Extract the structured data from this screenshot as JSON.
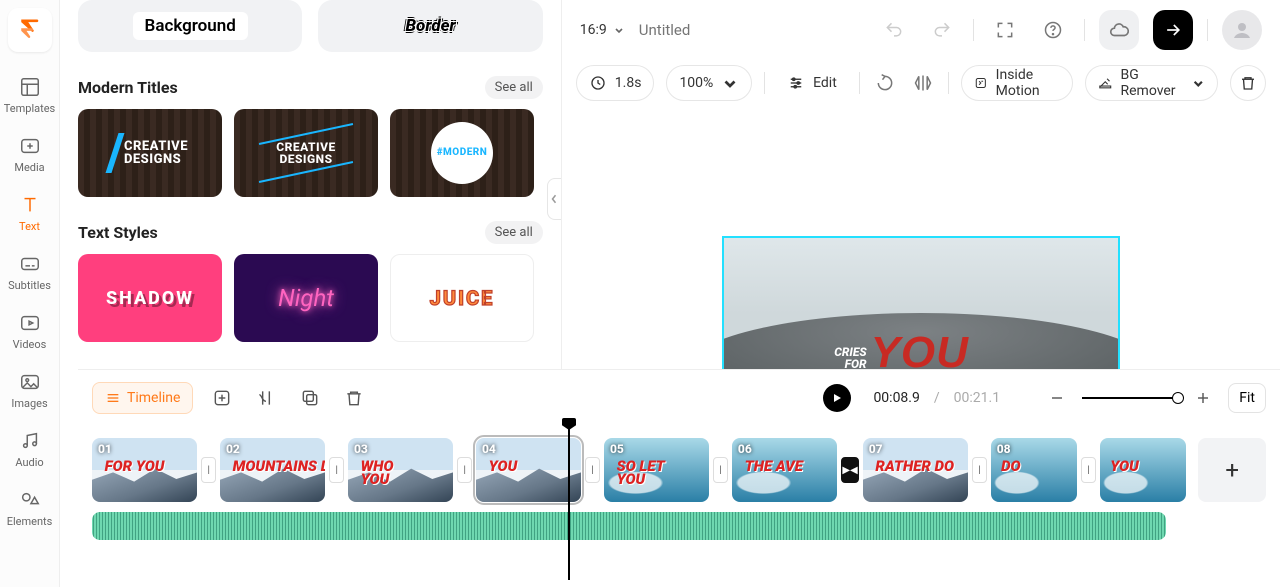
{
  "nav": {
    "items": [
      {
        "label": "Templates"
      },
      {
        "label": "Media"
      },
      {
        "label": "Text"
      },
      {
        "label": "Subtitles"
      },
      {
        "label": "Videos"
      },
      {
        "label": "Images"
      },
      {
        "label": "Audio"
      },
      {
        "label": "Elements"
      }
    ],
    "active_index": 2
  },
  "panel": {
    "pills": {
      "background": "Background",
      "border": "Border"
    },
    "sections": [
      {
        "title": "Modern Titles",
        "see_all": "See all",
        "thumbs": [
          "CREATIVE\nDESIGNS",
          "CREATIVE\nDESIGNS",
          "#MODERN"
        ]
      },
      {
        "title": "Text Styles",
        "see_all": "See all",
        "thumbs": [
          "SHADOW",
          "Night",
          "JUICE"
        ]
      }
    ]
  },
  "header": {
    "ratio": "16:9",
    "title_placeholder": "Untitled"
  },
  "toolbar": {
    "duration": "1.8s",
    "zoom": "100%",
    "edit": "Edit",
    "inside_motion": "Inside Motion",
    "bg_remover": "BG Remover"
  },
  "canvas": {
    "text_small": "CRIES\nFOR",
    "text_big": "YOU"
  },
  "timeline": {
    "tab": "Timeline",
    "current": "00:08.9",
    "total": "00:21.1",
    "sep": " / ",
    "fit": "Fit",
    "clips": [
      {
        "num": "01",
        "cap": "FOR YOU",
        "bg": "mtn"
      },
      {
        "num": "02",
        "cap": "MOUNTAINS DO",
        "bg": "mtn"
      },
      {
        "num": "03",
        "cap": "WHO\nYOU",
        "bg": "mtn"
      },
      {
        "num": "04",
        "cap": "YOU",
        "bg": "mtn",
        "selected": true
      },
      {
        "num": "05",
        "cap": "SO LET\nYOU",
        "bg": "wave"
      },
      {
        "num": "06",
        "cap": "THE AVE",
        "bg": "wave",
        "trans_black": true
      },
      {
        "num": "07",
        "cap": "RATHER DO",
        "bg": "mtn"
      },
      {
        "num": "08",
        "cap": "DO",
        "bg": "wave"
      },
      {
        "num": "",
        "cap": "YOU",
        "bg": "wave"
      }
    ]
  }
}
